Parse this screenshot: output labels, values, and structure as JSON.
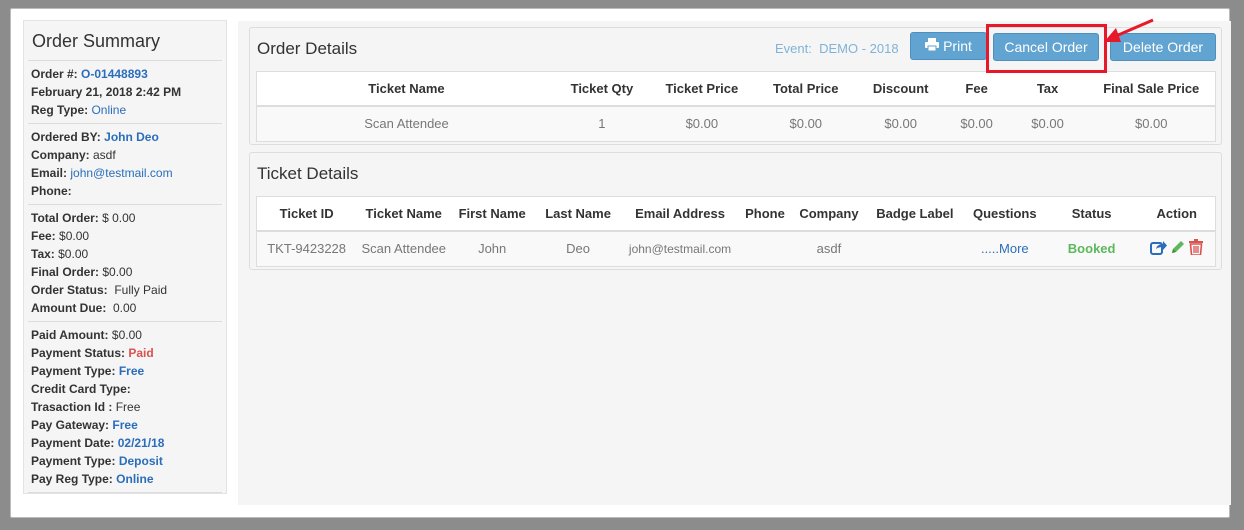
{
  "summary": {
    "title": "Order Summary",
    "order_no_label": "Order #:",
    "order_no": "O-01448893",
    "date": "February 21, 2018 2:42 PM",
    "reg_type_label": "Reg Type:",
    "reg_type": "Online",
    "ordered_by_label": "Ordered BY:",
    "ordered_by": "John Deo",
    "company_label": "Company:",
    "company": " asdf",
    "email_label": "Email:",
    "email": "john@testmail.com",
    "phone_label": "Phone:",
    "total_order_label": "Total Order:",
    "total_order": " $ 0.00",
    "fee_label": "Fee:",
    "fee": " $0.00",
    "tax_label": "Tax:",
    "tax": " $0.00",
    "final_order_label": "Final Order:",
    "final_order": " $0.00",
    "order_status_label": "Order Status:",
    "order_status": "  Fully Paid",
    "amount_due_label": "Amount Due:",
    "amount_due": "  0.00",
    "paid_amount_label": "Paid Amount:",
    "paid_amount": " $0.00",
    "payment_status_label": "Payment Status:",
    "payment_status": "Paid",
    "payment_type_label": "Payment Type:",
    "payment_type": "Free",
    "credit_card_type_label": "Credit Card Type:",
    "transaction_id_label": "Trasaction Id :",
    "transaction_id": " Free",
    "pay_gateway_label": "Pay Gateway:",
    "pay_gateway": "Free",
    "payment_date_label": "Payment Date:",
    "payment_date": "02/21/18",
    "payment_type2_label": "Payment Type:",
    "payment_type2": "Deposit",
    "pay_reg_type_label": "Pay Reg Type:",
    "pay_reg_type": "Online"
  },
  "order_details": {
    "title": "Order Details",
    "event": "Event:  DEMO - 2018",
    "print_label": "Print",
    "cancel_label": "Cancel Order",
    "delete_label": "Delete Order",
    "columns": [
      "Ticket Name",
      "Ticket Qty",
      "Ticket Price",
      "Total Price",
      "Discount",
      "Fee",
      "Tax",
      "Final Sale Price"
    ],
    "rows": [
      [
        "Scan Attendee",
        "1",
        "$0.00",
        "$0.00",
        "$0.00",
        "$0.00",
        "$0.00",
        "$0.00"
      ]
    ]
  },
  "ticket_details": {
    "title": "Ticket Details",
    "columns": [
      "Ticket ID",
      "Ticket Name",
      "First Name",
      "Last Name",
      "Email Address",
      "Phone",
      "Company",
      "Badge Label",
      "Questions",
      "Status",
      "Action"
    ],
    "row": {
      "ticket_id": "TKT-9423228",
      "ticket_name": "Scan Attendee",
      "first_name": "John",
      "last_name": "Deo",
      "email": "john@testmail.com",
      "phone": "",
      "company": "asdf",
      "badge_label": "",
      "questions": ".....More",
      "status": "Booked"
    }
  },
  "colors": {
    "accent": "#62a4d1",
    "link": "#2a6ebb",
    "booked": "#5cb85c",
    "paid": "#d9534f",
    "highlight": "#e8182b"
  },
  "icons": {
    "print": "printer-icon",
    "share": "share-icon",
    "edit": "pencil-icon",
    "delete": "trash-icon",
    "annotation": "red-arrow-icon"
  }
}
